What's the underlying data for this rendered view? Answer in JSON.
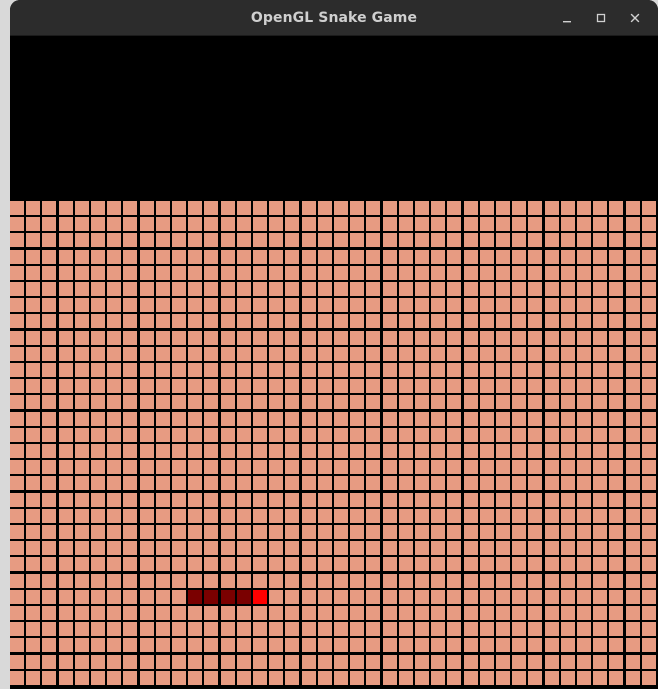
{
  "window": {
    "title": "OpenGL Snake Game"
  },
  "controls": {
    "minimize_icon": "minimize-icon",
    "maximize_icon": "maximize-icon",
    "close_icon": "close-icon"
  },
  "colors": {
    "background": "#000000",
    "cell": "#e79b82",
    "snake_head": "#ff0000",
    "snake_body": "#7a0000"
  },
  "game": {
    "grid_columns": 40,
    "grid_rows": 30,
    "snake": [
      {
        "col": 11,
        "row": 24,
        "part": "body"
      },
      {
        "col": 12,
        "row": 24,
        "part": "body"
      },
      {
        "col": 13,
        "row": 24,
        "part": "body"
      },
      {
        "col": 14,
        "row": 24,
        "part": "body"
      },
      {
        "col": 15,
        "row": 24,
        "part": "head"
      }
    ]
  }
}
